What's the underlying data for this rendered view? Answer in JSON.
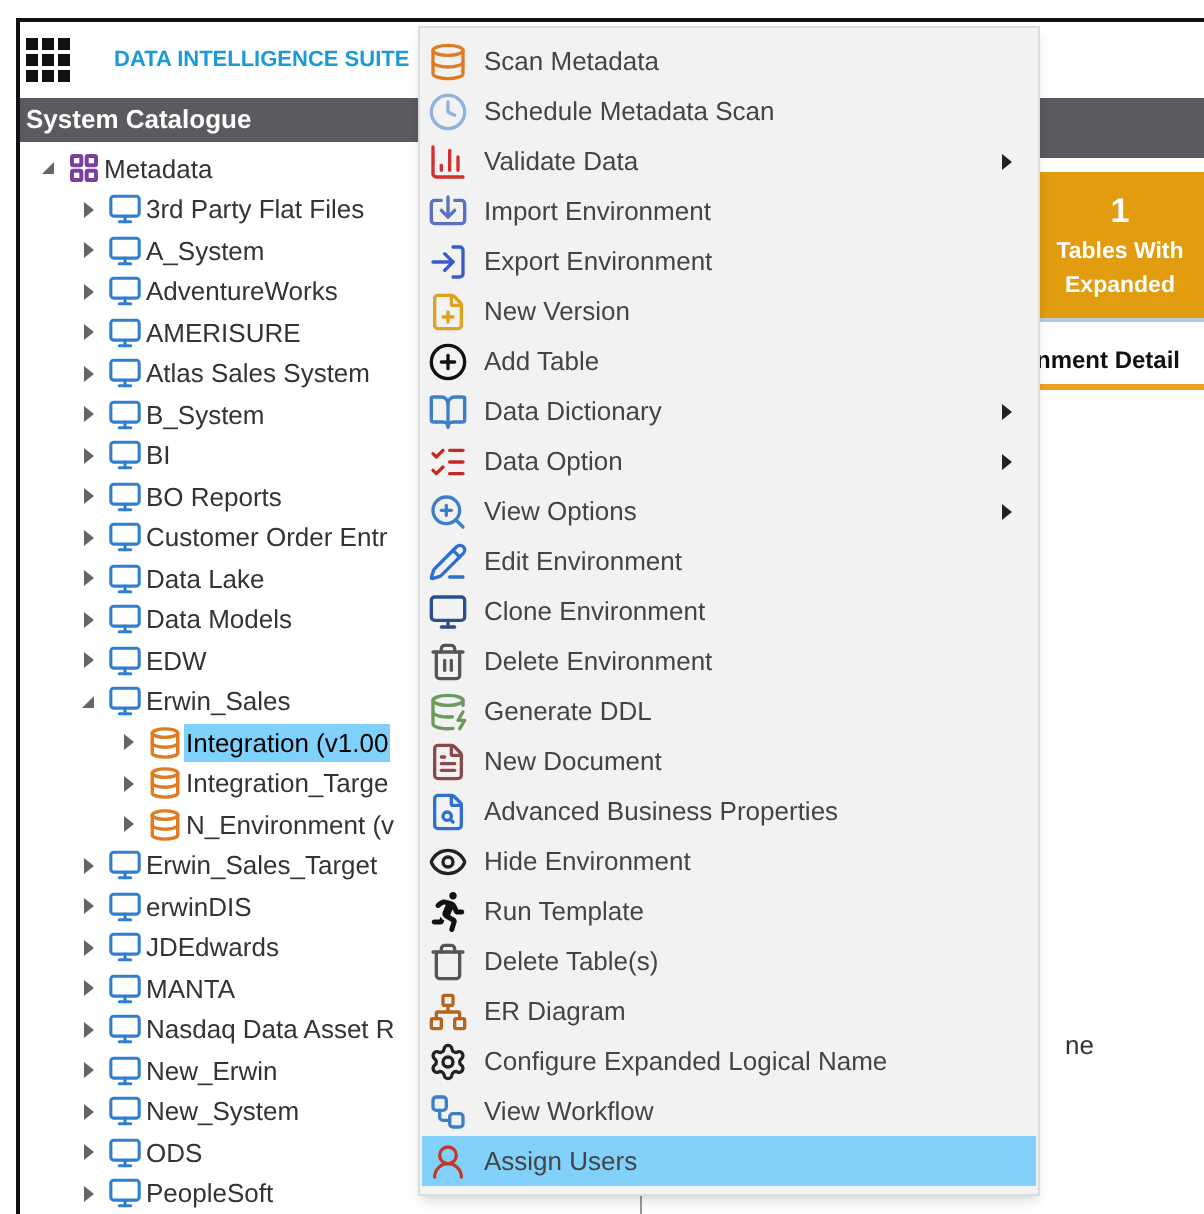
{
  "header": {
    "title": "DATA INTELLIGENCE SUITE"
  },
  "panel": {
    "title": "System Catalogue"
  },
  "tree": [
    {
      "label": "Metadata",
      "kind": "root",
      "expanded": true,
      "selected": false,
      "children": [
        {
          "label": "3rd Party Flat Files",
          "kind": "system",
          "expanded": false,
          "selected": false
        },
        {
          "label": "A_System",
          "kind": "system",
          "expanded": false,
          "selected": false
        },
        {
          "label": "AdventureWorks",
          "kind": "system",
          "expanded": false,
          "selected": false
        },
        {
          "label": "AMERISURE",
          "kind": "system",
          "expanded": false,
          "selected": false
        },
        {
          "label": "Atlas Sales System",
          "kind": "system",
          "expanded": false,
          "selected": false
        },
        {
          "label": "B_System",
          "kind": "system",
          "expanded": false,
          "selected": false
        },
        {
          "label": "BI",
          "kind": "system",
          "expanded": false,
          "selected": false
        },
        {
          "label": "BO Reports",
          "kind": "system",
          "expanded": false,
          "selected": false
        },
        {
          "label": "Customer Order Entr",
          "kind": "system",
          "expanded": false,
          "selected": false
        },
        {
          "label": "Data Lake",
          "kind": "system",
          "expanded": false,
          "selected": false
        },
        {
          "label": "Data Models",
          "kind": "system",
          "expanded": false,
          "selected": false
        },
        {
          "label": "EDW",
          "kind": "system",
          "expanded": false,
          "selected": false
        },
        {
          "label": "Erwin_Sales",
          "kind": "system",
          "expanded": true,
          "selected": false,
          "children": [
            {
              "label": "Integration (v1.00",
              "kind": "environment",
              "expanded": false,
              "selected": true
            },
            {
              "label": "Integration_Targe",
              "kind": "environment",
              "expanded": false,
              "selected": false
            },
            {
              "label": "N_Environment (v",
              "kind": "environment",
              "expanded": false,
              "selected": false
            }
          ]
        },
        {
          "label": "Erwin_Sales_Target",
          "kind": "system",
          "expanded": false,
          "selected": false
        },
        {
          "label": "erwinDIS",
          "kind": "system",
          "expanded": false,
          "selected": false
        },
        {
          "label": "JDEdwards",
          "kind": "system",
          "expanded": false,
          "selected": false
        },
        {
          "label": "MANTA",
          "kind": "system",
          "expanded": false,
          "selected": false
        },
        {
          "label": "Nasdaq Data Asset R",
          "kind": "system",
          "expanded": false,
          "selected": false
        },
        {
          "label": "New_Erwin",
          "kind": "system",
          "expanded": false,
          "selected": false
        },
        {
          "label": "New_System",
          "kind": "system",
          "expanded": false,
          "selected": false
        },
        {
          "label": "ODS",
          "kind": "system",
          "expanded": false,
          "selected": false
        },
        {
          "label": "PeopleSoft",
          "kind": "system",
          "expanded": false,
          "selected": false
        }
      ]
    }
  ],
  "summary_card": {
    "count": "1",
    "line_1": "Tables With",
    "line_2": "Expanded"
  },
  "details_tab": {
    "label": "nment Detail"
  },
  "content_text": "ne",
  "context_menu": [
    {
      "label": "Scan Metadata",
      "submenu": false,
      "selected": false
    },
    {
      "label": "Schedule Metadata Scan",
      "submenu": false,
      "selected": false
    },
    {
      "label": "Validate Data",
      "submenu": true,
      "selected": false
    },
    {
      "label": "Import Environment",
      "submenu": false,
      "selected": false
    },
    {
      "label": "Export Environment",
      "submenu": false,
      "selected": false
    },
    {
      "label": "New Version",
      "submenu": false,
      "selected": false
    },
    {
      "label": "Add Table",
      "submenu": false,
      "selected": false
    },
    {
      "label": "Data Dictionary",
      "submenu": true,
      "selected": false
    },
    {
      "label": "Data Option",
      "submenu": true,
      "selected": false
    },
    {
      "label": "View Options",
      "submenu": true,
      "selected": false
    },
    {
      "label": "Edit Environment",
      "submenu": false,
      "selected": false
    },
    {
      "label": "Clone Environment",
      "submenu": false,
      "selected": false
    },
    {
      "label": "Delete Environment",
      "submenu": false,
      "selected": false
    },
    {
      "label": "Generate DDL",
      "submenu": false,
      "selected": false
    },
    {
      "label": "New Document",
      "submenu": false,
      "selected": false
    },
    {
      "label": "Advanced Business Properties",
      "submenu": false,
      "selected": false
    },
    {
      "label": "Hide Environment",
      "submenu": false,
      "selected": false
    },
    {
      "label": "Run Template",
      "submenu": false,
      "selected": false
    },
    {
      "label": "Delete Table(s)",
      "submenu": false,
      "selected": false
    },
    {
      "label": "ER Diagram",
      "submenu": false,
      "selected": false
    },
    {
      "label": "Configure Expanded Logical Name",
      "submenu": false,
      "selected": false
    },
    {
      "label": "View Workflow",
      "submenu": false,
      "selected": false
    },
    {
      "label": "Assign Users",
      "submenu": false,
      "selected": true
    }
  ]
}
